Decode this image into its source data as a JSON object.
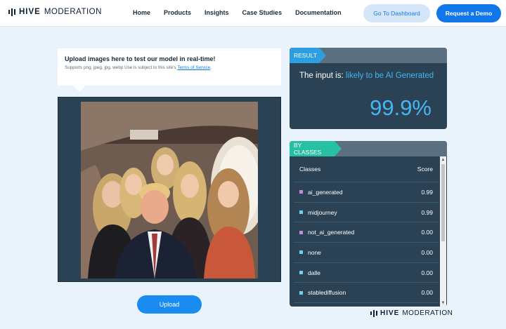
{
  "brand": {
    "bold": "HIVE",
    "light": "MODERATION"
  },
  "nav": [
    "Home",
    "Products",
    "Insights",
    "Case Studies",
    "Documentation"
  ],
  "header_buttons": {
    "dashboard": "Go To Dashboard",
    "demo": "Request a Demo"
  },
  "upload_info": {
    "title": "Upload images here to test our model in real-time!",
    "subtitle": "Supports png, jpeg, jpg, webp Use is subject to this site's",
    "tos_link": "Terms of Service",
    "tos_end": "."
  },
  "upload_button": "Upload",
  "result": {
    "tag": "RESULT",
    "prefix": "The input is:",
    "verdict": "likely to be AI Generated",
    "percent": "99.9%"
  },
  "classes": {
    "tag": "BY CLASSES",
    "col_class": "Classes",
    "col_score": "Score",
    "rows": [
      {
        "name": "ai_generated",
        "score": "0.99",
        "color": "#c78ad8"
      },
      {
        "name": "midjourney",
        "score": "0.99",
        "color": "#6fd2ea"
      },
      {
        "name": "not_ai_generated",
        "score": "0.00",
        "color": "#c78ad8"
      },
      {
        "name": "none",
        "score": "0.00",
        "color": "#6fd2ea"
      },
      {
        "name": "dalle",
        "score": "0.00",
        "color": "#6fd2ea"
      },
      {
        "name": "stablediffusion",
        "score": "0.00",
        "color": "#6fd2ea"
      }
    ]
  },
  "colors": {
    "accent": "#1177e8",
    "result_tag": "#2d9fe0",
    "classes_tag": "#27c0a2",
    "panel": "#2b4154"
  }
}
